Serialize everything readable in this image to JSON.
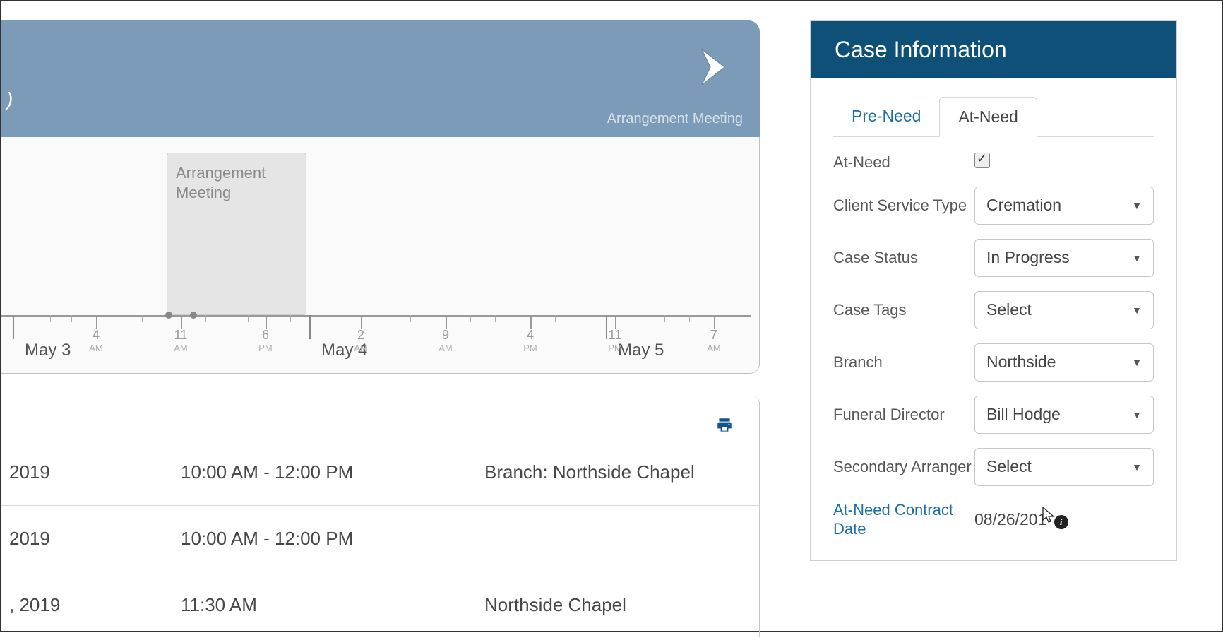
{
  "header": {
    "truncated_suffix": ")",
    "next_label": "Arrangement Meeting"
  },
  "timeline": {
    "event_label": "Arrangement Meeting",
    "dates": [
      "May 3",
      "May 4",
      "May 5"
    ],
    "ticks": [
      {
        "h": "4",
        "ap": "AM"
      },
      {
        "h": "11",
        "ap": "AM"
      },
      {
        "h": "6",
        "ap": "PM"
      },
      {
        "h": "2",
        "ap": "AM"
      },
      {
        "h": "9",
        "ap": "AM"
      },
      {
        "h": "4",
        "ap": "PM"
      },
      {
        "h": "11",
        "ap": "PM"
      },
      {
        "h": "7",
        "ap": "AM"
      }
    ]
  },
  "details": {
    "rows": [
      {
        "date": "2019",
        "time": "10:00 AM - 12:00 PM",
        "loc": "Branch: Northside Chapel"
      },
      {
        "date": "2019",
        "time": "10:00 AM - 12:00 PM",
        "loc": ""
      },
      {
        "date": ", 2019",
        "time": "11:30 AM",
        "loc": "Northside Chapel"
      }
    ]
  },
  "side": {
    "title": "Case Information",
    "tabs": [
      "Pre-Need",
      "At-Need"
    ],
    "form": {
      "at_need_label": "At-Need",
      "at_need_checked": true,
      "client_service_type": {
        "label": "Client Service Type",
        "value": "Cremation"
      },
      "case_status": {
        "label": "Case Status",
        "value": "In Progress"
      },
      "case_tags": {
        "label": "Case Tags",
        "value": "Select"
      },
      "branch": {
        "label": "Branch",
        "value": "Northside"
      },
      "funeral_director": {
        "label": "Funeral Director",
        "value": "Bill Hodge"
      },
      "secondary_arranger": {
        "label": "Secondary Arranger",
        "value": "Select"
      },
      "contract_date": {
        "label": "At-Need Contract Date",
        "value": "08/26/201"
      }
    }
  }
}
